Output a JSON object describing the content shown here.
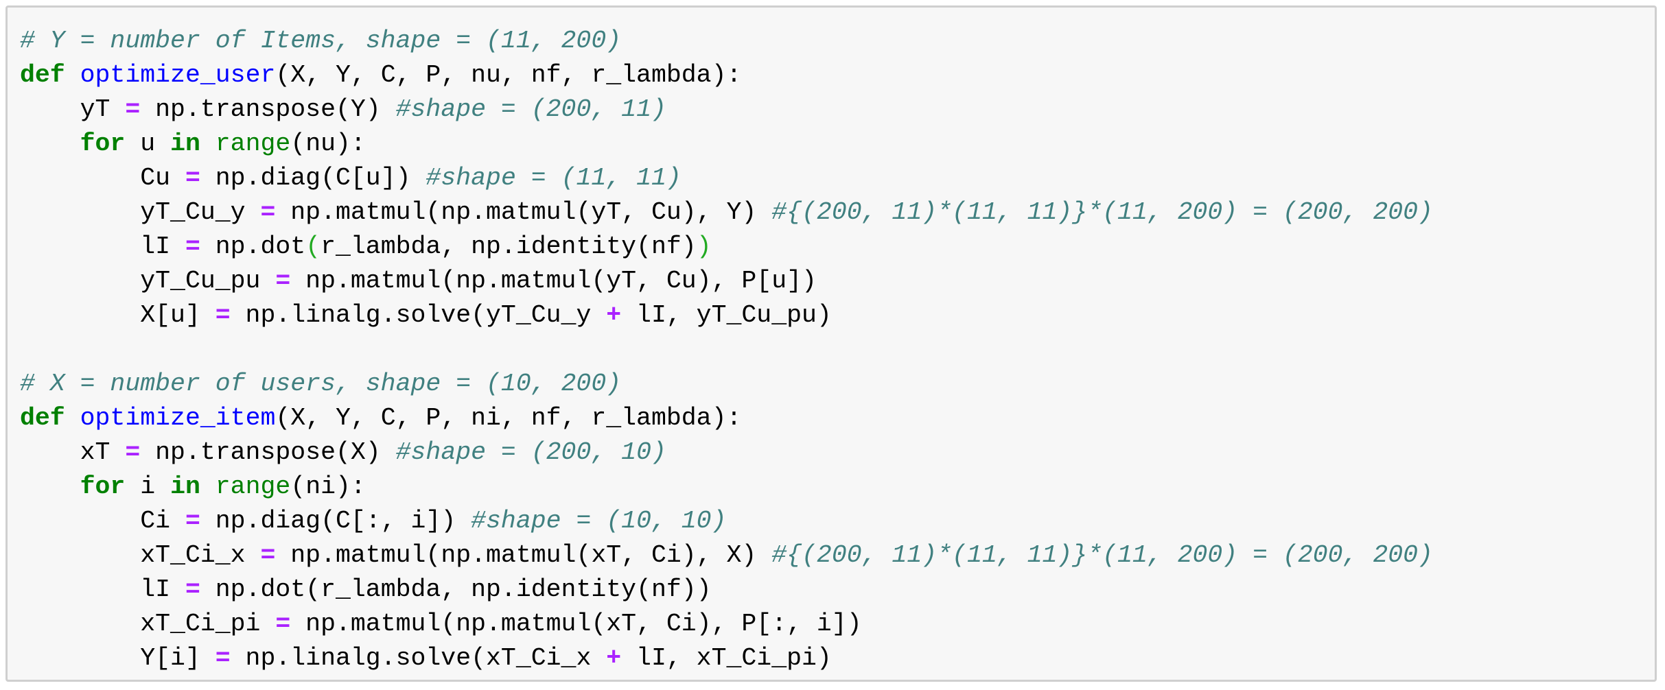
{
  "cell": {
    "lines": [
      [
        {
          "t": "# Y = number of Items, shape = (11, 200)",
          "c": "comment"
        }
      ],
      [
        {
          "t": "def",
          "c": "kw"
        },
        {
          "t": " ",
          "c": "text"
        },
        {
          "t": "optimize_user",
          "c": "func"
        },
        {
          "t": "(X, Y, C, P, nu, nf, r_lambda):",
          "c": "text"
        }
      ],
      [
        {
          "t": "    yT ",
          "c": "text"
        },
        {
          "t": "=",
          "c": "op"
        },
        {
          "t": " np.transpose(Y) ",
          "c": "text"
        },
        {
          "t": "#shape = (200, 11)",
          "c": "comment"
        }
      ],
      [
        {
          "t": "    ",
          "c": "text"
        },
        {
          "t": "for",
          "c": "kw"
        },
        {
          "t": " u ",
          "c": "text"
        },
        {
          "t": "in",
          "c": "kw"
        },
        {
          "t": " ",
          "c": "text"
        },
        {
          "t": "range",
          "c": "builtin"
        },
        {
          "t": "(nu):",
          "c": "text"
        }
      ],
      [
        {
          "t": "        Cu ",
          "c": "text"
        },
        {
          "t": "=",
          "c": "op"
        },
        {
          "t": " np.diag(C[u]) ",
          "c": "text"
        },
        {
          "t": "#shape = (11, 11)",
          "c": "comment"
        }
      ],
      [
        {
          "t": "        yT_Cu_y ",
          "c": "text"
        },
        {
          "t": "=",
          "c": "op"
        },
        {
          "t": " np.matmul(np.matmul(yT, Cu), Y) ",
          "c": "text"
        },
        {
          "t": "#{(200, 11)*(11, 11)}*(11, 200) = (200, 200)",
          "c": "comment"
        }
      ],
      [
        {
          "t": "        lI ",
          "c": "text"
        },
        {
          "t": "=",
          "c": "op"
        },
        {
          "t": " np.dot",
          "c": "text"
        },
        {
          "t": "(",
          "c": "paren-hl"
        },
        {
          "t": "r_lambda, np.identity(nf)",
          "c": "text"
        },
        {
          "t": ")",
          "c": "paren-hl"
        }
      ],
      [
        {
          "t": "        yT_Cu_pu ",
          "c": "text"
        },
        {
          "t": "=",
          "c": "op"
        },
        {
          "t": " np.matmul(np.matmul(yT, Cu), P[u])",
          "c": "text"
        }
      ],
      [
        {
          "t": "        X[u] ",
          "c": "text"
        },
        {
          "t": "=",
          "c": "op"
        },
        {
          "t": " np.linalg.solve(yT_Cu_y ",
          "c": "text"
        },
        {
          "t": "+",
          "c": "op"
        },
        {
          "t": " lI, yT_Cu_pu)",
          "c": "text"
        }
      ],
      [],
      [
        {
          "t": "# X = number of users, shape = (10, 200)",
          "c": "comment"
        }
      ],
      [
        {
          "t": "def",
          "c": "kw"
        },
        {
          "t": " ",
          "c": "text"
        },
        {
          "t": "optimize_item",
          "c": "func"
        },
        {
          "t": "(X, Y, C, P, ni, nf, r_lambda):",
          "c": "text"
        }
      ],
      [
        {
          "t": "    xT ",
          "c": "text"
        },
        {
          "t": "=",
          "c": "op"
        },
        {
          "t": " np.transpose(X) ",
          "c": "text"
        },
        {
          "t": "#shape = (200, 10)",
          "c": "comment"
        }
      ],
      [
        {
          "t": "    ",
          "c": "text"
        },
        {
          "t": "for",
          "c": "kw"
        },
        {
          "t": " i ",
          "c": "text"
        },
        {
          "t": "in",
          "c": "kw"
        },
        {
          "t": " ",
          "c": "text"
        },
        {
          "t": "range",
          "c": "builtin"
        },
        {
          "t": "(ni):",
          "c": "text"
        }
      ],
      [
        {
          "t": "        Ci ",
          "c": "text"
        },
        {
          "t": "=",
          "c": "op"
        },
        {
          "t": " np.diag(C[:, i]) ",
          "c": "text"
        },
        {
          "t": "#shape = (10, 10)",
          "c": "comment"
        }
      ],
      [
        {
          "t": "        xT_Ci_x ",
          "c": "text"
        },
        {
          "t": "=",
          "c": "op"
        },
        {
          "t": " np.matmul(np.matmul(xT, Ci), X) ",
          "c": "text"
        },
        {
          "t": "#{(200, 11)*(11, 11)}*(11, 200) = (200, 200)",
          "c": "comment"
        }
      ],
      [
        {
          "t": "        lI ",
          "c": "text"
        },
        {
          "t": "=",
          "c": "op"
        },
        {
          "t": " np.dot(r_lambda, np.identity(nf))",
          "c": "text"
        }
      ],
      [
        {
          "t": "        xT_Ci_pi ",
          "c": "text"
        },
        {
          "t": "=",
          "c": "op"
        },
        {
          "t": " np.matmul(np.matmul(xT, Ci), P[:, i])",
          "c": "text"
        }
      ],
      [
        {
          "t": "        Y[i] ",
          "c": "text"
        },
        {
          "t": "=",
          "c": "op"
        },
        {
          "t": " np.linalg.solve(xT_Ci_x ",
          "c": "text"
        },
        {
          "t": "+",
          "c": "op"
        },
        {
          "t": " lI, xT_Ci_pi)",
          "c": "text"
        }
      ]
    ]
  },
  "colors": {
    "keyword": "#008000",
    "function_name": "#0000ff",
    "builtin": "#008000",
    "operator": "#aa22ff",
    "comment": "#408080",
    "matched_paren": "#22aa22",
    "text": "#000000",
    "cell_background": "#f7f7f7",
    "cell_border": "#cfcfcf"
  }
}
